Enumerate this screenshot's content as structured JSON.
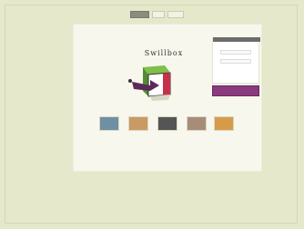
{
  "nav": {
    "items": [
      {
        "label": "",
        "active": true
      },
      {
        "label": ""
      },
      {
        "label": ""
      }
    ]
  },
  "brand": {
    "logo_text": "Swillbox",
    "tagline": ""
  },
  "login": {
    "title": "",
    "signup_label": ""
  },
  "thumbs": [
    {
      "label": "",
      "color": "#6f8fa3"
    },
    {
      "label": "",
      "color": "#c99a63"
    },
    {
      "label": "",
      "color": "#555555"
    },
    {
      "label": "",
      "color": "#a88c7a"
    },
    {
      "label": "",
      "color": "#d69b4a"
    }
  ],
  "footer": {
    "text": ""
  }
}
